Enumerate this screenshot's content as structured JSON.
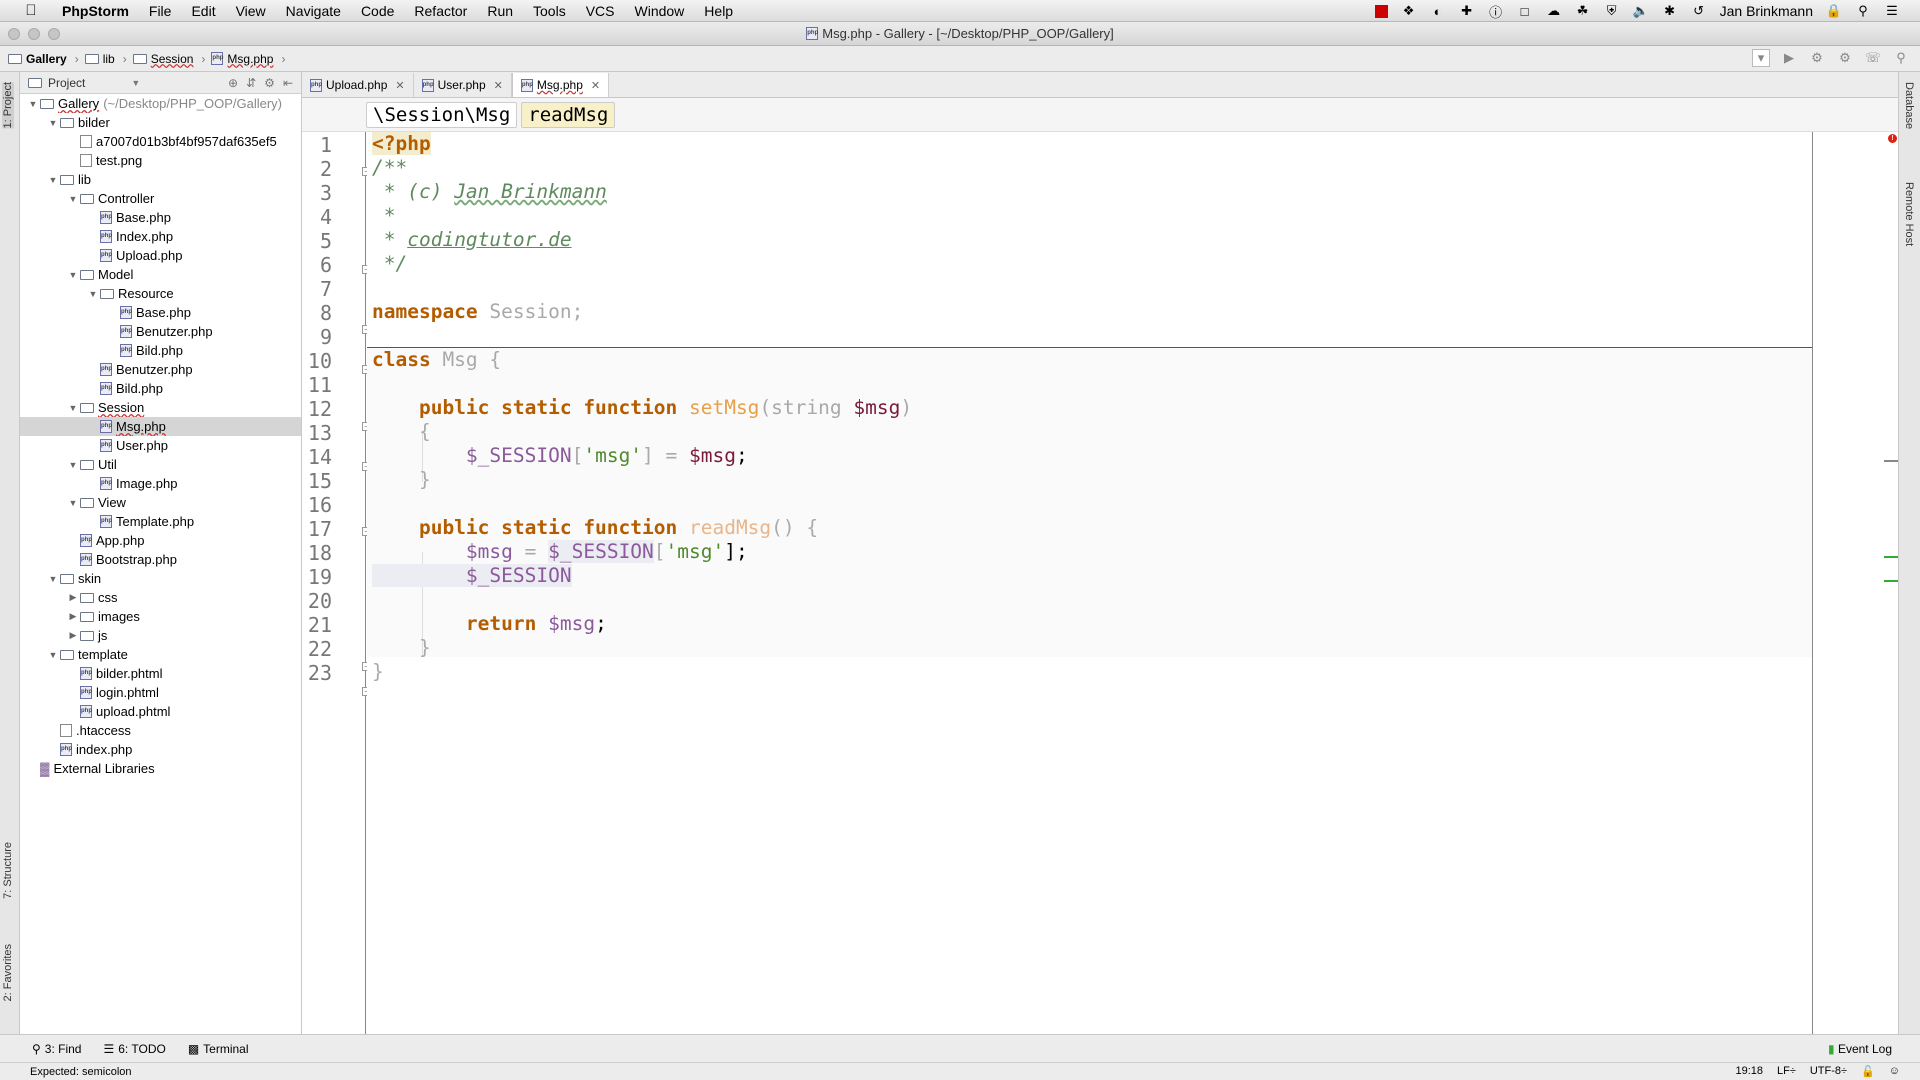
{
  "menubar": {
    "app": "PhpStorm",
    "items": [
      "File",
      "Edit",
      "View",
      "Navigate",
      "Code",
      "Refactor",
      "Run",
      "Tools",
      "VCS",
      "Window",
      "Help"
    ],
    "user": "Jan Brinkmann"
  },
  "window": {
    "title": "Msg.php - Gallery - [~/Desktop/PHP_OOP/Gallery]"
  },
  "breadcrumb": [
    "Gallery",
    "lib",
    "Session",
    "Msg.php"
  ],
  "project_panel": {
    "title": "Project",
    "tree": [
      {
        "label": "Gallery",
        "path": "(~/Desktop/PHP_OOP/Gallery)",
        "depth": 0,
        "open": true,
        "type": "folder"
      },
      {
        "label": "bilder",
        "depth": 1,
        "open": true,
        "type": "folder"
      },
      {
        "label": "a7007d01b3bf4bf957daf635ef5",
        "depth": 2,
        "type": "file"
      },
      {
        "label": "test.png",
        "depth": 2,
        "type": "file"
      },
      {
        "label": "lib",
        "depth": 1,
        "open": true,
        "type": "folder"
      },
      {
        "label": "Controller",
        "depth": 2,
        "open": true,
        "type": "folder"
      },
      {
        "label": "Base.php",
        "depth": 3,
        "type": "php"
      },
      {
        "label": "Index.php",
        "depth": 3,
        "type": "php"
      },
      {
        "label": "Upload.php",
        "depth": 3,
        "type": "php"
      },
      {
        "label": "Model",
        "depth": 2,
        "open": true,
        "type": "folder"
      },
      {
        "label": "Resource",
        "depth": 3,
        "open": true,
        "type": "folder"
      },
      {
        "label": "Base.php",
        "depth": 4,
        "type": "php"
      },
      {
        "label": "Benutzer.php",
        "depth": 4,
        "type": "php"
      },
      {
        "label": "Bild.php",
        "depth": 4,
        "type": "php"
      },
      {
        "label": "Benutzer.php",
        "depth": 3,
        "type": "php"
      },
      {
        "label": "Bild.php",
        "depth": 3,
        "type": "php"
      },
      {
        "label": "Session",
        "depth": 2,
        "open": true,
        "type": "folder"
      },
      {
        "label": "Msg.php",
        "depth": 3,
        "type": "php",
        "selected": true
      },
      {
        "label": "User.php",
        "depth": 3,
        "type": "php"
      },
      {
        "label": "Util",
        "depth": 2,
        "open": true,
        "type": "folder"
      },
      {
        "label": "Image.php",
        "depth": 3,
        "type": "php"
      },
      {
        "label": "View",
        "depth": 2,
        "open": true,
        "type": "folder"
      },
      {
        "label": "Template.php",
        "depth": 3,
        "type": "php"
      },
      {
        "label": "App.php",
        "depth": 2,
        "type": "php"
      },
      {
        "label": "Bootstrap.php",
        "depth": 2,
        "type": "php"
      },
      {
        "label": "skin",
        "depth": 1,
        "open": true,
        "type": "folder"
      },
      {
        "label": "css",
        "depth": 2,
        "open": false,
        "type": "folder"
      },
      {
        "label": "images",
        "depth": 2,
        "open": false,
        "type": "folder"
      },
      {
        "label": "js",
        "depth": 2,
        "open": false,
        "type": "folder"
      },
      {
        "label": "template",
        "depth": 1,
        "open": true,
        "type": "folder"
      },
      {
        "label": "bilder.phtml",
        "depth": 2,
        "type": "php"
      },
      {
        "label": "login.phtml",
        "depth": 2,
        "type": "php"
      },
      {
        "label": "upload.phtml",
        "depth": 2,
        "type": "php"
      },
      {
        "label": ".htaccess",
        "depth": 1,
        "type": "file"
      },
      {
        "label": "index.php",
        "depth": 1,
        "type": "php"
      },
      {
        "label": "External Libraries",
        "depth": 0,
        "type": "lib"
      }
    ]
  },
  "tabs": [
    {
      "label": "Upload.php",
      "active": false
    },
    {
      "label": "User.php",
      "active": false
    },
    {
      "label": "Msg.php",
      "active": true
    }
  ],
  "context": {
    "namespace": "\\Session\\Msg",
    "function": "readMsg"
  },
  "code": {
    "line_numbers": [
      "1",
      "2",
      "3",
      "4",
      "5",
      "6",
      "7",
      "8",
      "9",
      "10",
      "11",
      "12",
      "13",
      "14",
      "15",
      "16",
      "17",
      "18",
      "19",
      "20",
      "21",
      "22",
      "23"
    ],
    "l1": "<?php",
    "l2": "/**",
    "l3a": " * (c) ",
    "l3b": "Jan Brinkmann",
    "l4": " *",
    "l5a": " * ",
    "l5b": "codingtutor.de",
    "l6": " */",
    "l8a": "namespace",
    "l8b": " Session;",
    "l10a": "class",
    "l10b": " Msg {",
    "l12a": "    public static function ",
    "l12b": "setMsg",
    "l12c": "(string ",
    "l12d": "$msg",
    "l12e": ")",
    "l13": "    {",
    "l14a": "        $_SESSION",
    "l14b": "[",
    "l14c": "'msg'",
    "l14d": "] = ",
    "l14e": "$msg",
    "l14f": ";",
    "l15": "    }",
    "l17a": "    public static function ",
    "l17b": "readMsg",
    "l17c": "() {",
    "l18a": "        $msg",
    "l18b": " = ",
    "l18c": "$_SESSION",
    "l18d": "[",
    "l18e": "'msg'",
    "l18f": "];",
    "l19": "        $_SESSION",
    "l21a": "        return ",
    "l21b": "$msg",
    "l21c": ";",
    "l22": "    }",
    "l23": "}"
  },
  "left_tool_windows": [
    "1: Project",
    "7: Structure",
    "2: Favorites"
  ],
  "right_tool_windows": [
    "Database",
    "Remote Host"
  ],
  "bottom_tools": [
    {
      "key": "3",
      "label": "3: Find"
    },
    {
      "key": "6",
      "label": "6: TODO"
    },
    {
      "key": "t",
      "label": "Terminal"
    }
  ],
  "event_log": "Event Log",
  "status": {
    "message": "Expected: semicolon",
    "position": "19:18",
    "line_sep": "LF÷",
    "encoding": "UTF-8÷"
  }
}
